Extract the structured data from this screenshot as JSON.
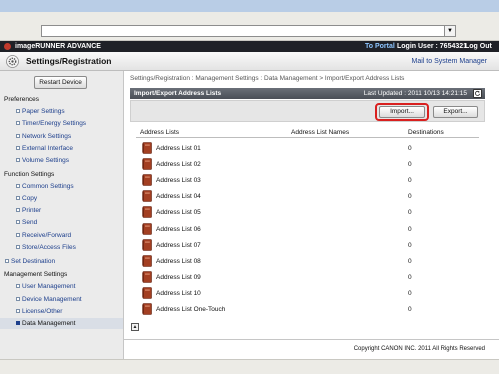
{
  "browser": {
    "address": ""
  },
  "header": {
    "product": "imageRUNNER ADVANCE",
    "portal": "To Portal",
    "login": "Login User : 7654321",
    "logout": "Log Out"
  },
  "title": {
    "text": "Settings/Registration",
    "mail": "Mail to System Manager"
  },
  "sidebar": {
    "restart": "Restart Device",
    "groups": [
      {
        "title": "Preferences",
        "items": [
          "Paper Settings",
          "Timer/Energy Settings",
          "Network Settings",
          "External Interface",
          "Volume Settings"
        ]
      },
      {
        "title": "Function Settings",
        "items": [
          "Common Settings",
          "Copy",
          "Printer",
          "Send",
          "Receive/Forward",
          "Store/Access Files"
        ]
      },
      {
        "title": "Set Destination",
        "items": []
      },
      {
        "title": "Management Settings",
        "items": [
          "User Management",
          "Device Management",
          "License/Other",
          "Data Management"
        ]
      }
    ],
    "active": "Data Management"
  },
  "main": {
    "breadcrumb": "Settings/Registration : Management Settings : Data Management > Import/Export Address Lists",
    "section_title": "Import/Export Address Lists",
    "last_updated": "Last Updated : 2011 10/13 14:21:15",
    "import": "Import...",
    "export": "Export...",
    "columns": [
      "Address Lists",
      "Address List Names",
      "Destinations"
    ],
    "rows": [
      {
        "name": "Address List 01",
        "dest": "0"
      },
      {
        "name": "Address List 02",
        "dest": "0"
      },
      {
        "name": "Address List 03",
        "dest": "0"
      },
      {
        "name": "Address List 04",
        "dest": "0"
      },
      {
        "name": "Address List 05",
        "dest": "0"
      },
      {
        "name": "Address List 06",
        "dest": "0"
      },
      {
        "name": "Address List 07",
        "dest": "0"
      },
      {
        "name": "Address List 08",
        "dest": "0"
      },
      {
        "name": "Address List 09",
        "dest": "0"
      },
      {
        "name": "Address List 10",
        "dest": "0"
      },
      {
        "name": "Address List One-Touch",
        "dest": "0"
      }
    ]
  },
  "footer": {
    "copyright": "Copyright CANON INC. 2011 All Rights Reserved"
  },
  "colors": {
    "highlight": "#d9201f",
    "link": "#1d3f8c",
    "header_bg": "#1f2127",
    "section_bar": "#555a63",
    "book": "#a33f22"
  }
}
